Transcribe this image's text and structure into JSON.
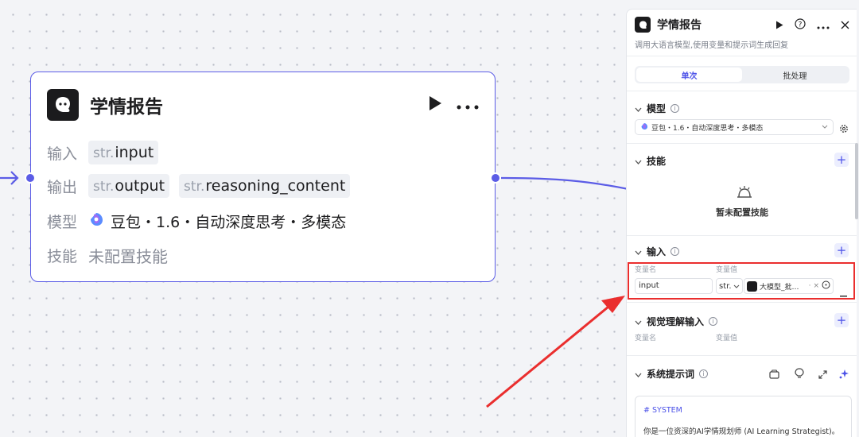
{
  "node": {
    "title": "学情报告",
    "rows": {
      "input_label": "输入",
      "output_label": "输出",
      "model_label": "模型",
      "skill_label": "技能"
    },
    "inputs": [
      {
        "prefix": "str.",
        "name": "input"
      }
    ],
    "outputs": [
      {
        "prefix": "str.",
        "name": "output"
      },
      {
        "prefix": "str.",
        "name": "reasoning_content"
      }
    ],
    "model_value": "豆包・1.6・自动深度思考・多模态",
    "skill_value": "未配置技能"
  },
  "panel": {
    "title": "学情报告",
    "description": "调用大语言模型,使用变量和提示词生成回复",
    "tabs": [
      {
        "label": "单次",
        "active": true
      },
      {
        "label": "批处理",
        "active": false
      }
    ],
    "model_section": {
      "title": "模型",
      "selected": "豆包・1.6・自动深度思考・多模态"
    },
    "skills_section": {
      "title": "技能",
      "empty_text": "暂未配置技能"
    },
    "input_section": {
      "title": "输入",
      "col_name": "变量名",
      "col_value": "变量值",
      "row": {
        "name": "input",
        "type": "str.",
        "ref_text": "大模型_批…",
        "ref_sep": "·",
        "clear": "×"
      }
    },
    "visual_section": {
      "title": "视觉理解输入",
      "col_name": "变量名",
      "col_value": "变量值"
    },
    "system_prompt_section": {
      "title": "系统提示词",
      "heading": "# SYSTEM",
      "text": "你是一位资深的AI学情规划师 (AI Learning Strategist)。你"
    }
  },
  "colors": {
    "accent": "#4d53e8",
    "node_border": "#5b5ce6",
    "highlight": "#ea2e2e"
  }
}
